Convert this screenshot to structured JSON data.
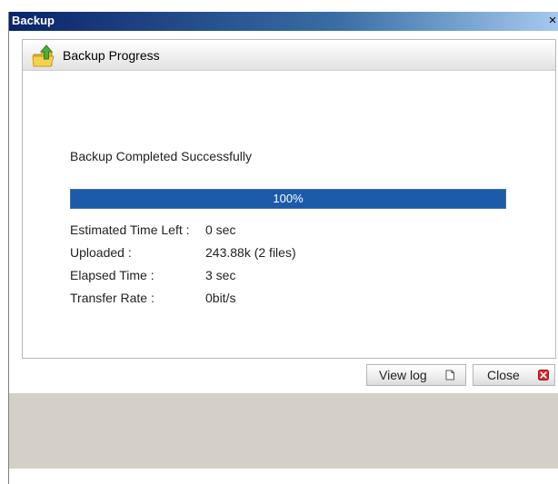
{
  "window": {
    "title": "Backup",
    "close_glyph": "×"
  },
  "panel": {
    "header_icon": "folder-upload-icon",
    "header_title": "Backup Progress"
  },
  "status": {
    "message": "Backup Completed Successfully"
  },
  "progress": {
    "percent_label": "100%",
    "value": 1.0,
    "fill_color": "#1c5baa"
  },
  "details": [
    {
      "label": "Estimated Time Left :",
      "value": "0 sec"
    },
    {
      "label": "Uploaded :",
      "value": "243.88k (2 files)"
    },
    {
      "label": "Elapsed Time :",
      "value": "3 sec"
    },
    {
      "label": "Transfer Rate :",
      "value": "0bit/s"
    }
  ],
  "buttons": {
    "view_log": {
      "label": "View log",
      "icon": "document-icon"
    },
    "close": {
      "label": "Close",
      "icon": "close-red-icon"
    }
  },
  "colors": {
    "title_bar_start": "#0a246a",
    "title_bar_end": "#a6caf0",
    "footer": "#d4d0c8",
    "close_icon": "#d9272e"
  }
}
